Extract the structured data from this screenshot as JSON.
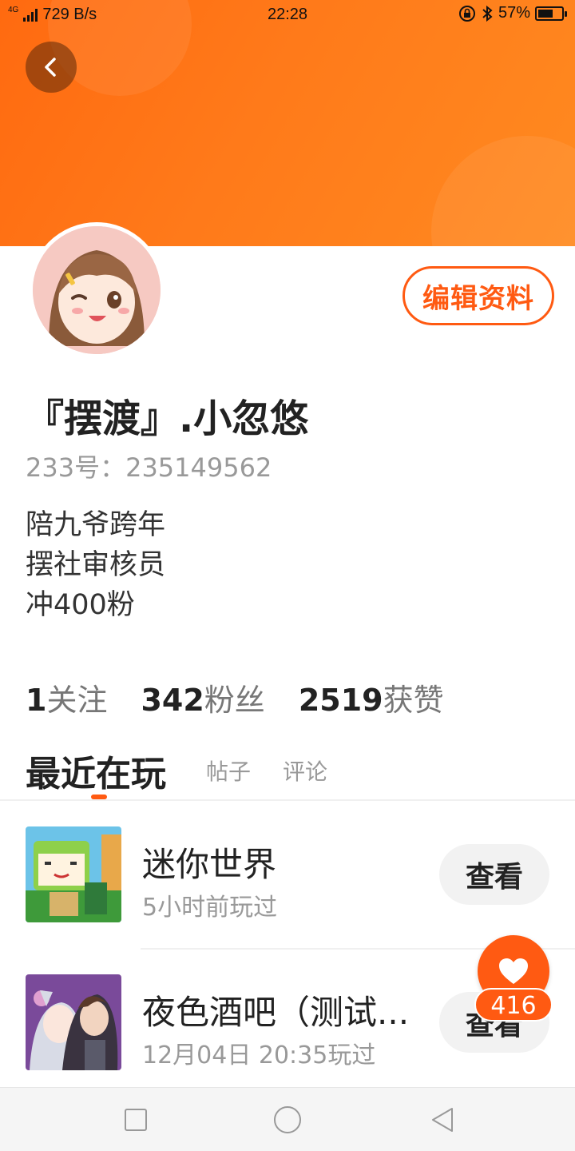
{
  "status_bar": {
    "network": "4G",
    "speed": "729 B/s",
    "time": "22:28",
    "battery": "57%",
    "battery_level": 0.57
  },
  "header": {
    "back_icon": "chevron-left-icon",
    "banner_color": "#ff7a1a"
  },
  "profile": {
    "name": "『摆渡』.小忽悠",
    "uid": "233号：235149562",
    "bio": [
      "陪九爷跨年",
      "摆社审核员",
      "冲400粉"
    ],
    "edit_label": "编辑资料"
  },
  "stats": [
    {
      "num": "1",
      "label": "关注"
    },
    {
      "num": "342",
      "label": "粉丝"
    },
    {
      "num": "2519",
      "label": "获赞"
    }
  ],
  "tabs": {
    "active": "最近在玩",
    "items": [
      "帖子",
      "评论"
    ]
  },
  "games": [
    {
      "title": "迷你世界",
      "time": "5小时前玩过",
      "button": "查看"
    },
    {
      "title": "夜色酒吧（测试...",
      "time": "12月04日 20:35玩过",
      "button": "查看"
    }
  ],
  "like": {
    "count": "416",
    "icon": "heart-icon"
  },
  "accent_color": "#ff5a12"
}
